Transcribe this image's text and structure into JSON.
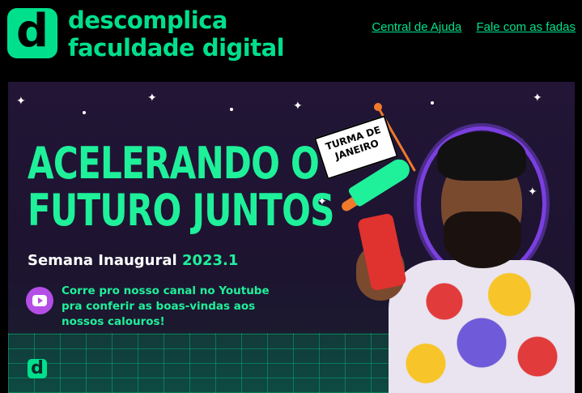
{
  "brand": {
    "name_line1": "descomplica",
    "name_line2": "faculdade digital",
    "logo_letter": "d",
    "accent_color": "#00e08c"
  },
  "nav": {
    "help_label": "Central de Ajuda",
    "contact_label": "Fale com as fadas"
  },
  "banner": {
    "headline_line1": "ACELERANDO O",
    "headline_line2": "FUTURO JUNTOS",
    "subtitle_prefix": "Semana Inaugural",
    "subtitle_year": "2023.1",
    "cta_line1": "Corre pro nosso canal no Youtube",
    "cta_line2": "pra conferir as boas-vindas aos",
    "cta_line3": "nossos calouros!",
    "flag_line1": "TURMA DE",
    "flag_line2": "JANEIRO",
    "small_logo_letter": "d",
    "youtube_icon": "youtube-play-icon"
  }
}
